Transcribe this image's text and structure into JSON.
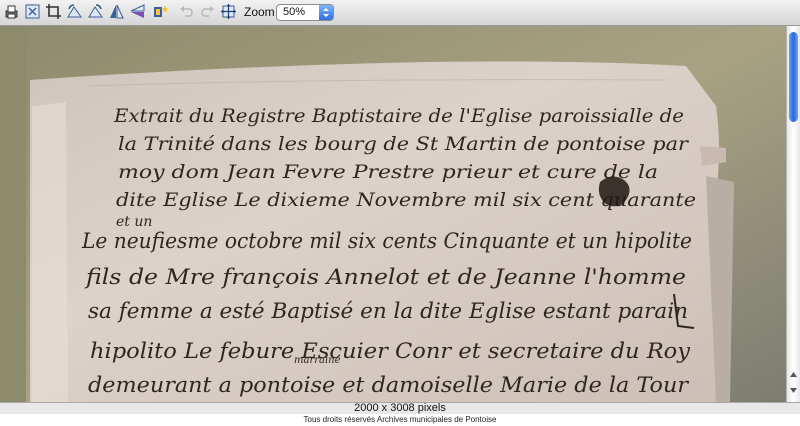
{
  "toolbar": {
    "buttons": [
      {
        "icon": "print-icon"
      },
      {
        "icon": "fit-page-icon"
      },
      {
        "icon": "crop-icon"
      },
      {
        "icon": "rotate-left-icon"
      },
      {
        "icon": "rotate-right-icon"
      },
      {
        "icon": "flip-horizontal-icon"
      },
      {
        "icon": "flip-vertical-icon"
      },
      {
        "icon": "color-adjust-icon"
      },
      {
        "icon": "undo-icon"
      },
      {
        "icon": "redo-icon"
      },
      {
        "icon": "fit-window-icon"
      }
    ],
    "zoom_label": "Zoom",
    "zoom_value": "50%"
  },
  "document": {
    "handwriting_lines": [
      "Extrait du Registre Baptistaire de l'Eglise paroissialle de",
      "la Trinité dans les bourg de St Martin de pontoise par",
      "moy dom Jean Fevre Prestre prieur et cure de la",
      "dite Eglise Le dixieme Novembre mil six cent quarante",
      "et un",
      "Le neufiesme octobre mil six cents Cinquante et un hipolite",
      "fils de Mre françois Annelot et de Jeanne l'homme",
      "sa femme a esté Baptisé en la dite Eglise estant parain",
      "hipolito Le febure Escuier Conr et secretaire du Roy",
      "demeurant a pontoise et damoiselle Marie de la Tour"
    ],
    "interlinear_note": "marraine"
  },
  "status": {
    "dimensions": "2000 x 3008 pixels"
  },
  "caption": "Tous droits réservés Archives municipales de Pontoise",
  "colors": {
    "parchment": "#d9cfc6",
    "ink": "#2e2620",
    "background": "#7b7b6f",
    "scroll_accent": "#2a66d8"
  }
}
